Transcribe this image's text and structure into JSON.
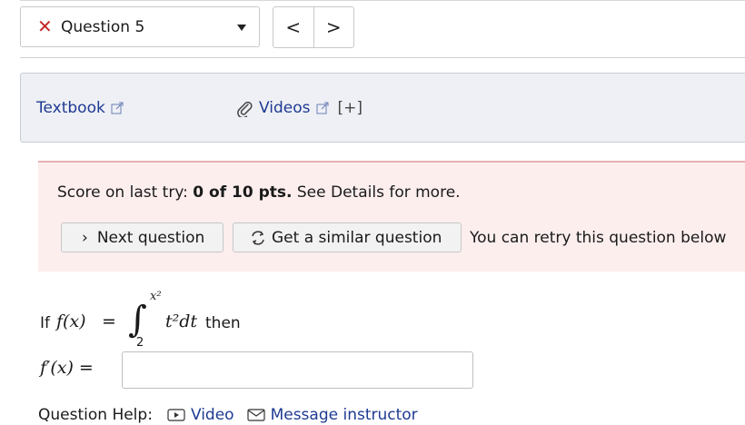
{
  "question_nav": {
    "current_question": "Question 5",
    "status_icon": "x-icon",
    "prev_label": "<",
    "next_label": ">"
  },
  "resources": {
    "textbook_label": "Textbook",
    "videos_label": "Videos",
    "videos_expand": "[+]"
  },
  "score": {
    "prefix": "Score on last try: ",
    "value": "0 of 10 pts.",
    "suffix": " See Details for more.",
    "next_question_label": "Next question",
    "similar_question_label": "Get a similar question",
    "retry_text": "You can retry this question below"
  },
  "question": {
    "if_text": "If",
    "function": "f(x)",
    "equals": "=",
    "integral_sign": "∫",
    "upper_limit": "x²",
    "lower_limit": "2",
    "integrand": "t²dt",
    "then_text": "then",
    "derivative_label": "f′(x) =",
    "answer_value": ""
  },
  "help": {
    "label": "Question Help:",
    "video_label": "Video",
    "message_label": "Message instructor"
  },
  "colors": {
    "link": "#1f3a93",
    "error_x": "#c62828",
    "score_panel_bg": "#fdeeee",
    "resources_bg": "#eef0f5"
  }
}
